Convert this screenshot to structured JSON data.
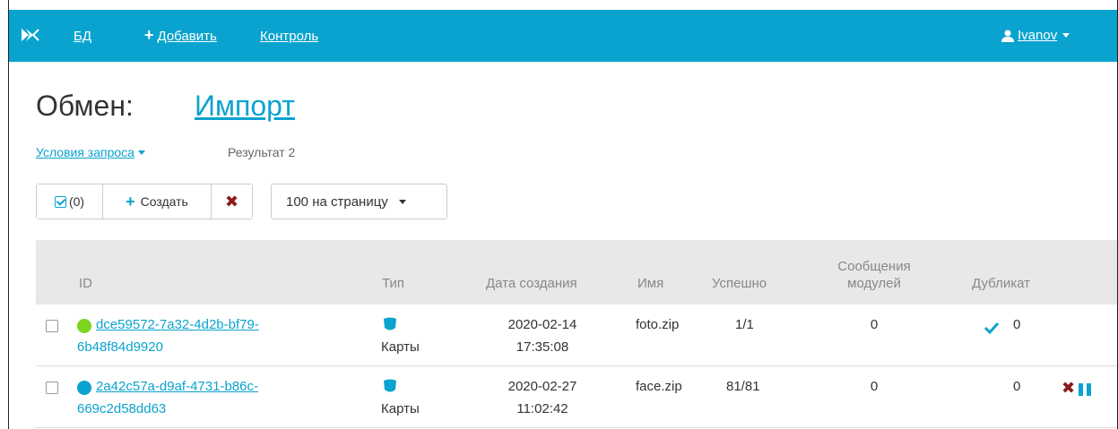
{
  "nav": {
    "db": "БД",
    "add": "Добавить",
    "control": "Контроль",
    "user": "Ivanov"
  },
  "page": {
    "title": "Обмен:",
    "link": "Импорт"
  },
  "filters": {
    "toggle": "Условия запроса",
    "result": "Результат 2"
  },
  "toolbar": {
    "selected_count": "(0)",
    "create": "Создать",
    "per_page": "100 на страницу"
  },
  "table": {
    "headers": {
      "id": "ID",
      "type": "Тип",
      "created": "Дата создания",
      "name": "Имя",
      "success": "Успешно",
      "messages_line1": "Сообщения",
      "messages_line2": "модулей",
      "duplicate": "Дубликат"
    },
    "rows": [
      {
        "id_line1": "dce59572-7a32-4d2b-bf79-",
        "id_line2": "6b48f84d9920",
        "status_color": "#7ed321",
        "type": "Карты",
        "date": "2020-02-14",
        "time": "17:35:08",
        "name": "foto.zip",
        "success": "1/1",
        "messages": "0",
        "duplicate": "0",
        "duplicate_checked": true
      },
      {
        "id_line1": "2a42c57a-d9af-4731-b86c-",
        "id_line2": "669c2d58dd63",
        "status_color": "#0aa3cf",
        "type": "Карты",
        "date": "2020-02-27",
        "time": "11:02:42",
        "name": "face.zip",
        "success": "81/81",
        "messages": "0",
        "duplicate": "0",
        "duplicate_checked": false
      }
    ]
  },
  "colors": {
    "brand": "#0aa3cf",
    "danger": "#8b1a1a",
    "header_bg": "#e8e8e8"
  }
}
